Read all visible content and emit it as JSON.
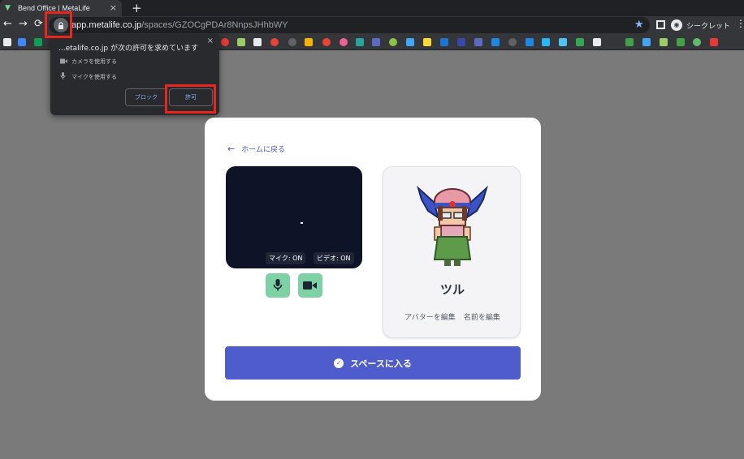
{
  "browser": {
    "tab_title": "Bend Office | MetaLife",
    "tab_close": "×",
    "new_tab": "+",
    "url_host": "app.metalife.co.jp",
    "url_path": "/spaces/GZOCgPDAr8NnpsJHhbWY",
    "incognito_label": "シークレット",
    "icons": {
      "back": "←",
      "forward": "→",
      "reload": "⟳",
      "lock": "🔒",
      "star": "★",
      "menu": "⋮"
    }
  },
  "permission_popup": {
    "title": "...etalife.co.jp が次の許可を求めています",
    "close": "×",
    "camera_label": "カメラを使用する",
    "mic_label": "マイクを使用する",
    "block_label": "ブロック",
    "allow_label": "許可"
  },
  "card": {
    "back_label": "ホームに戻る",
    "back_arrow": "←",
    "mic_status": "マイク: ON",
    "video_status": "ビデオ: ON",
    "avatar_name": "ツル",
    "edit_avatar_label": "アバターを編集",
    "edit_name_label": "名前を編集",
    "enter_label": "スペースに入る",
    "check": "✓"
  },
  "colors": {
    "accent": "#4f5ccc",
    "control_green": "#7ed1a4",
    "highlight_red": "#e8261e",
    "video_bg": "#0e1327"
  }
}
